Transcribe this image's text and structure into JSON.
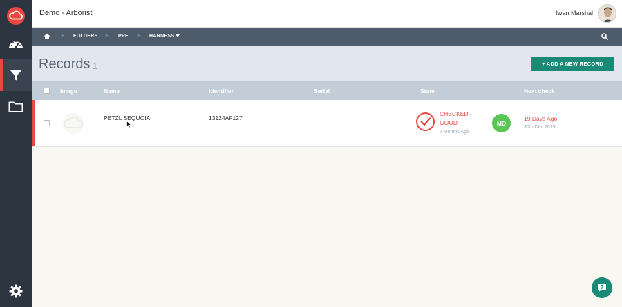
{
  "header": {
    "app_title": "Demo - Arborist",
    "user_name": "Iwan Marshal"
  },
  "sidebar": {
    "items": [
      {
        "name": "logo",
        "icon": "cloud-icon"
      },
      {
        "name": "dashboard",
        "icon": "speedometer-icon"
      },
      {
        "name": "filter",
        "icon": "filter-icon",
        "active": true
      },
      {
        "name": "folders",
        "icon": "folder-icon"
      },
      {
        "name": "settings",
        "icon": "gear-icon"
      }
    ]
  },
  "breadcrumb": {
    "home_icon": "home-icon",
    "separators": [
      ">",
      ">",
      ">"
    ],
    "items": [
      "FOLDERS",
      "PPE",
      "HARNESS"
    ],
    "search_icon": "search-icon"
  },
  "records": {
    "title": "Records",
    "count": "1",
    "add_button": "+ ADD A NEW RECORD"
  },
  "table": {
    "columns": [
      "Image",
      "Name",
      "Identifier",
      "Serial",
      "State",
      "Next check"
    ],
    "rows": [
      {
        "name": "PETZL SEQUOIA",
        "identifier": "13124AF127",
        "serial": "",
        "state_line1": "CHECKED -",
        "state_line2": "GOOD",
        "state_time": "7 Months Ago",
        "inspector_initials": "MD",
        "next_check": "19 Days Ago",
        "next_check_date": "30th Dec 2015"
      }
    ]
  },
  "colors": {
    "accent_red": "#e8483f",
    "brand_green": "#188a75",
    "sidebar": "#2c3540",
    "badge_green": "#59c653"
  }
}
